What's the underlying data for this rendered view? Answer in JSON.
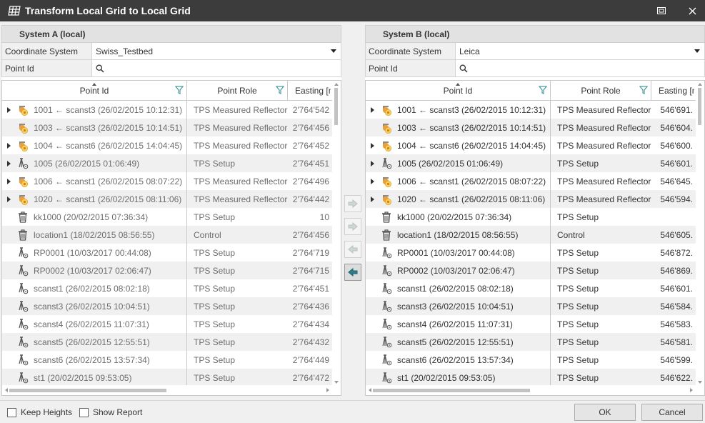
{
  "window": {
    "title": "Transform Local Grid to Local Grid"
  },
  "left": {
    "header": "System A (local)",
    "coord_label": "Coordinate System",
    "coord_value": "Swiss_Testbed",
    "pointid_label": "Point Id",
    "pointid_value": "",
    "columns": [
      "Point Id",
      "Point Role",
      "Easting [m]"
    ],
    "rows": [
      {
        "expander": true,
        "icon": "reflector-icon",
        "id": "1001 ← scanst3 (26/02/2015 10:12:31)",
        "role": "TPS Measured Reflector",
        "easting": "2'764'542"
      },
      {
        "expander": false,
        "icon": "reflector-icon",
        "id": "1003 ← scanst3 (26/02/2015 10:14:51)",
        "role": "TPS Measured Reflector",
        "easting": "2'764'456"
      },
      {
        "expander": true,
        "icon": "reflector-icon",
        "id": "1004 ← scanst6 (26/02/2015 14:04:45)",
        "role": "TPS Measured Reflector",
        "easting": "2'764'452"
      },
      {
        "expander": true,
        "icon": "setup-icon",
        "id": "1005 (26/02/2015 01:06:49)",
        "role": "TPS Setup",
        "easting": "2'764'451"
      },
      {
        "expander": true,
        "icon": "reflector-icon",
        "id": "1006 ← scanst1 (26/02/2015 08:07:22)",
        "role": "TPS Measured Reflector",
        "easting": "2'764'496"
      },
      {
        "expander": true,
        "icon": "reflector-icon",
        "id": "1020 ← scanst1 (26/02/2015 08:11:06)",
        "role": "TPS Measured Reflector",
        "easting": "2'764'442"
      },
      {
        "expander": false,
        "icon": "trash-icon",
        "id": "kk1000 (20/02/2015 07:36:34)",
        "role": "TPS Setup",
        "easting": "10"
      },
      {
        "expander": false,
        "icon": "trash-icon",
        "id": "location1 (18/02/2015 08:56:55)",
        "role": "Control",
        "easting": "2'764'456"
      },
      {
        "expander": false,
        "icon": "setup-icon",
        "id": "RP0001 (10/03/2017 00:44:08)",
        "role": "TPS Setup",
        "easting": "2'764'719"
      },
      {
        "expander": false,
        "icon": "setup-icon",
        "id": "RP0002 (10/03/2017 02:06:47)",
        "role": "TPS Setup",
        "easting": "2'764'715"
      },
      {
        "expander": false,
        "icon": "setup-icon",
        "id": "scanst1 (26/02/2015 08:02:18)",
        "role": "TPS Setup",
        "easting": "2'764'451"
      },
      {
        "expander": false,
        "icon": "setup-icon",
        "id": "scanst3 (26/02/2015 10:04:51)",
        "role": "TPS Setup",
        "easting": "2'764'436"
      },
      {
        "expander": false,
        "icon": "setup-icon",
        "id": "scanst4 (26/02/2015 11:07:31)",
        "role": "TPS Setup",
        "easting": "2'764'434"
      },
      {
        "expander": false,
        "icon": "setup-icon",
        "id": "scanst5 (26/02/2015 12:55:51)",
        "role": "TPS Setup",
        "easting": "2'764'432"
      },
      {
        "expander": false,
        "icon": "setup-icon",
        "id": "scanst6 (26/02/2015 13:57:34)",
        "role": "TPS Setup",
        "easting": "2'764'449"
      },
      {
        "expander": false,
        "icon": "setup-icon",
        "id": "st1 (20/02/2015 09:53:05)",
        "role": "TPS Setup",
        "easting": "2'764'472"
      }
    ]
  },
  "right": {
    "header": "System B (local)",
    "coord_label": "Coordinate System",
    "coord_value": "Leica",
    "pointid_label": "Point Id",
    "pointid_value": "",
    "columns": [
      "Point Id",
      "Point Role",
      "Easting [m]"
    ],
    "rows": [
      {
        "expander": true,
        "icon": "reflector-icon",
        "id": "1001 ← scanst3 (26/02/2015 10:12:31)",
        "role": "TPS Measured Reflector",
        "easting": "546'691."
      },
      {
        "expander": false,
        "icon": "reflector-icon",
        "id": "1003 ← scanst3 (26/02/2015 10:14:51)",
        "role": "TPS Measured Reflector",
        "easting": "546'604."
      },
      {
        "expander": true,
        "icon": "reflector-icon",
        "id": "1004 ← scanst6 (26/02/2015 14:04:45)",
        "role": "TPS Measured Reflector",
        "easting": "546'600."
      },
      {
        "expander": true,
        "icon": "setup-icon",
        "id": "1005 (26/02/2015 01:06:49)",
        "role": "TPS Setup",
        "easting": "546'601."
      },
      {
        "expander": true,
        "icon": "reflector-icon",
        "id": "1006 ← scanst1 (26/02/2015 08:07:22)",
        "role": "TPS Measured Reflector",
        "easting": "546'645."
      },
      {
        "expander": true,
        "icon": "reflector-icon",
        "id": "1020 ← scanst1 (26/02/2015 08:11:06)",
        "role": "TPS Measured Reflector",
        "easting": "546'594."
      },
      {
        "expander": false,
        "icon": "trash-icon",
        "id": "kk1000 (20/02/2015 07:36:34)",
        "role": "TPS Setup",
        "easting": ""
      },
      {
        "expander": false,
        "icon": "trash-icon",
        "id": "location1 (18/02/2015 08:56:55)",
        "role": "Control",
        "easting": "546'605."
      },
      {
        "expander": false,
        "icon": "setup-icon",
        "id": "RP0001 (10/03/2017 00:44:08)",
        "role": "TPS Setup",
        "easting": "546'872."
      },
      {
        "expander": false,
        "icon": "setup-icon",
        "id": "RP0002 (10/03/2017 02:06:47)",
        "role": "TPS Setup",
        "easting": "546'869."
      },
      {
        "expander": false,
        "icon": "setup-icon",
        "id": "scanst1 (26/02/2015 08:02:18)",
        "role": "TPS Setup",
        "easting": "546'601."
      },
      {
        "expander": false,
        "icon": "setup-icon",
        "id": "scanst3 (26/02/2015 10:04:51)",
        "role": "TPS Setup",
        "easting": "546'584."
      },
      {
        "expander": false,
        "icon": "setup-icon",
        "id": "scanst4 (26/02/2015 11:07:31)",
        "role": "TPS Setup",
        "easting": "546'583."
      },
      {
        "expander": false,
        "icon": "setup-icon",
        "id": "scanst5 (26/02/2015 12:55:51)",
        "role": "TPS Setup",
        "easting": "546'581."
      },
      {
        "expander": false,
        "icon": "setup-icon",
        "id": "scanst6 (26/02/2015 13:57:34)",
        "role": "TPS Setup",
        "easting": "546'599."
      },
      {
        "expander": false,
        "icon": "setup-icon",
        "id": "st1 (20/02/2015 09:53:05)",
        "role": "TPS Setup",
        "easting": "546'622."
      }
    ]
  },
  "footer": {
    "keep_heights": "Keep Heights",
    "show_report": "Show Report",
    "ok": "OK",
    "cancel": "Cancel"
  },
  "colors": {
    "titlebar": "#3c3c3c",
    "reflector_orange": "#e8a040",
    "reflector_yellow": "#f5d25a"
  }
}
